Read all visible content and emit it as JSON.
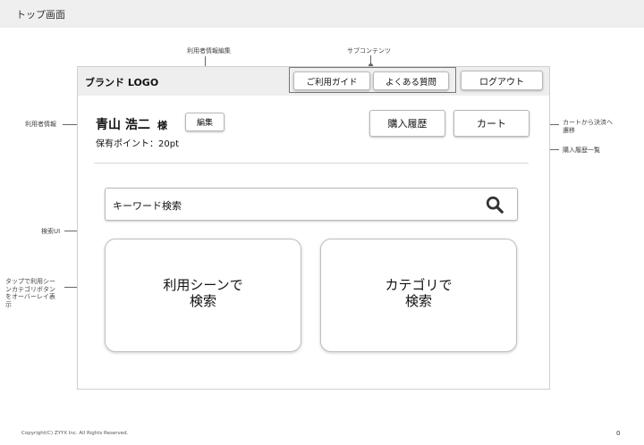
{
  "page_title": "トップ画面",
  "header": {
    "brand": "ブランド LOGO",
    "nav": [
      {
        "label": "ご利用ガイド"
      },
      {
        "label": "よくある質問"
      }
    ],
    "logout_label": "ログアウト"
  },
  "user": {
    "name": "青山 浩二",
    "suffix": "様",
    "points": "保有ポイント：20pt",
    "edit_label": "編集"
  },
  "actions": {
    "history_label": "購入履歴",
    "cart_label": "カート"
  },
  "search": {
    "text": "キーワード検索",
    "icon": "search-icon"
  },
  "cards": [
    {
      "line1": "利用シーンで",
      "line2": "検索"
    },
    {
      "line1": "カテゴリで",
      "line2": "検索"
    }
  ],
  "annotations": {
    "user_edit": "利用者情報編集",
    "sub_contents": "サブコンテンツ",
    "user_info": "利用者情報",
    "cart_note_1": "カートから決済へ",
    "cart_note_2": "遷移",
    "history_list": "購入履歴一覧",
    "search_ui": "検索UI",
    "overlay_1": "タップで利用シー",
    "overlay_2": "ンカテゴリボタン",
    "overlay_3": "をオーバーレイ表",
    "overlay_4": "示"
  },
  "footer": {
    "copyright": "Copyright(C) ZYYX Inc. All Rights Reserved.",
    "page_number": "0"
  }
}
